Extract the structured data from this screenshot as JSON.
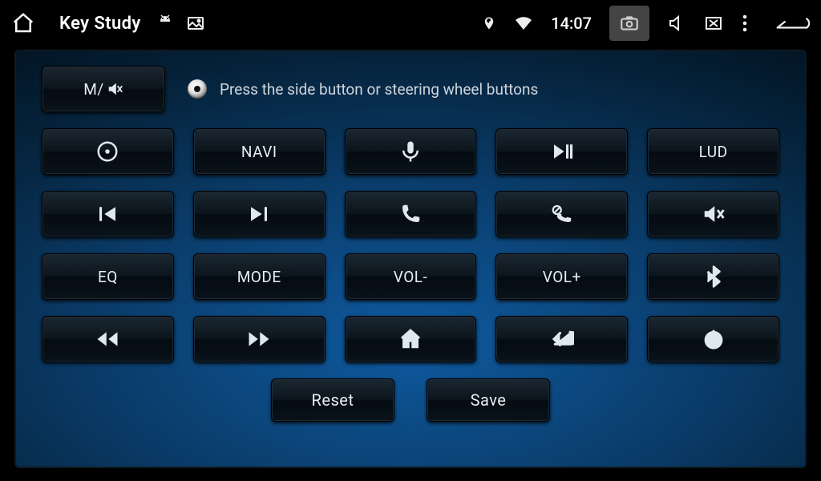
{
  "statusbar": {
    "title": "Key Study",
    "clock": "14:07"
  },
  "hint": "Press the side button or steering wheel buttons",
  "buttons": {
    "m_mute": "M/",
    "navi": "NAVI",
    "lud": "LUD",
    "eq": "EQ",
    "mode": "MODE",
    "vol_down": "VOL-",
    "vol_up": "VOL+"
  },
  "actions": {
    "reset": "Reset",
    "save": "Save"
  }
}
